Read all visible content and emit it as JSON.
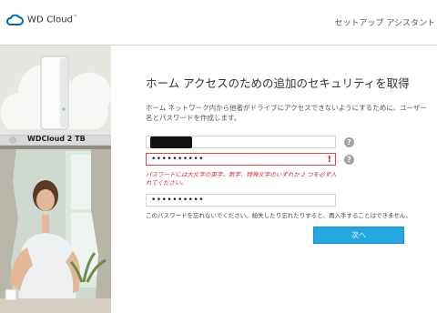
{
  "header": {
    "logo_text": "WD Cloud",
    "logo_mark": "™",
    "title": "セットアップ アシスタント"
  },
  "sidebar": {
    "drive_name": "WDCloud 2 TB"
  },
  "main": {
    "heading": "ホーム アクセスのための追加のセキュリティを取得",
    "description": "ホーム ネットワーク内から他者がドライブにアクセスできないようにするために、ユーザー名とパスワードを作成します。",
    "username_masked": "",
    "password_value": "••••••••••",
    "confirm_value": "••••••••••",
    "password_error": "パスワードには大文字の英字、数字、特殊文字のいずれか 2 つを必ず入れてください。",
    "error_mark": "!",
    "help_symbol": "?",
    "note": "このパスワードを忘れないでください。紛失したり忘れたりすると、再入手することはできません。",
    "next_label": "次へ"
  },
  "colors": {
    "accent": "#27a7e0",
    "error": "#d44444",
    "help_icon": "#a3a3a3"
  }
}
